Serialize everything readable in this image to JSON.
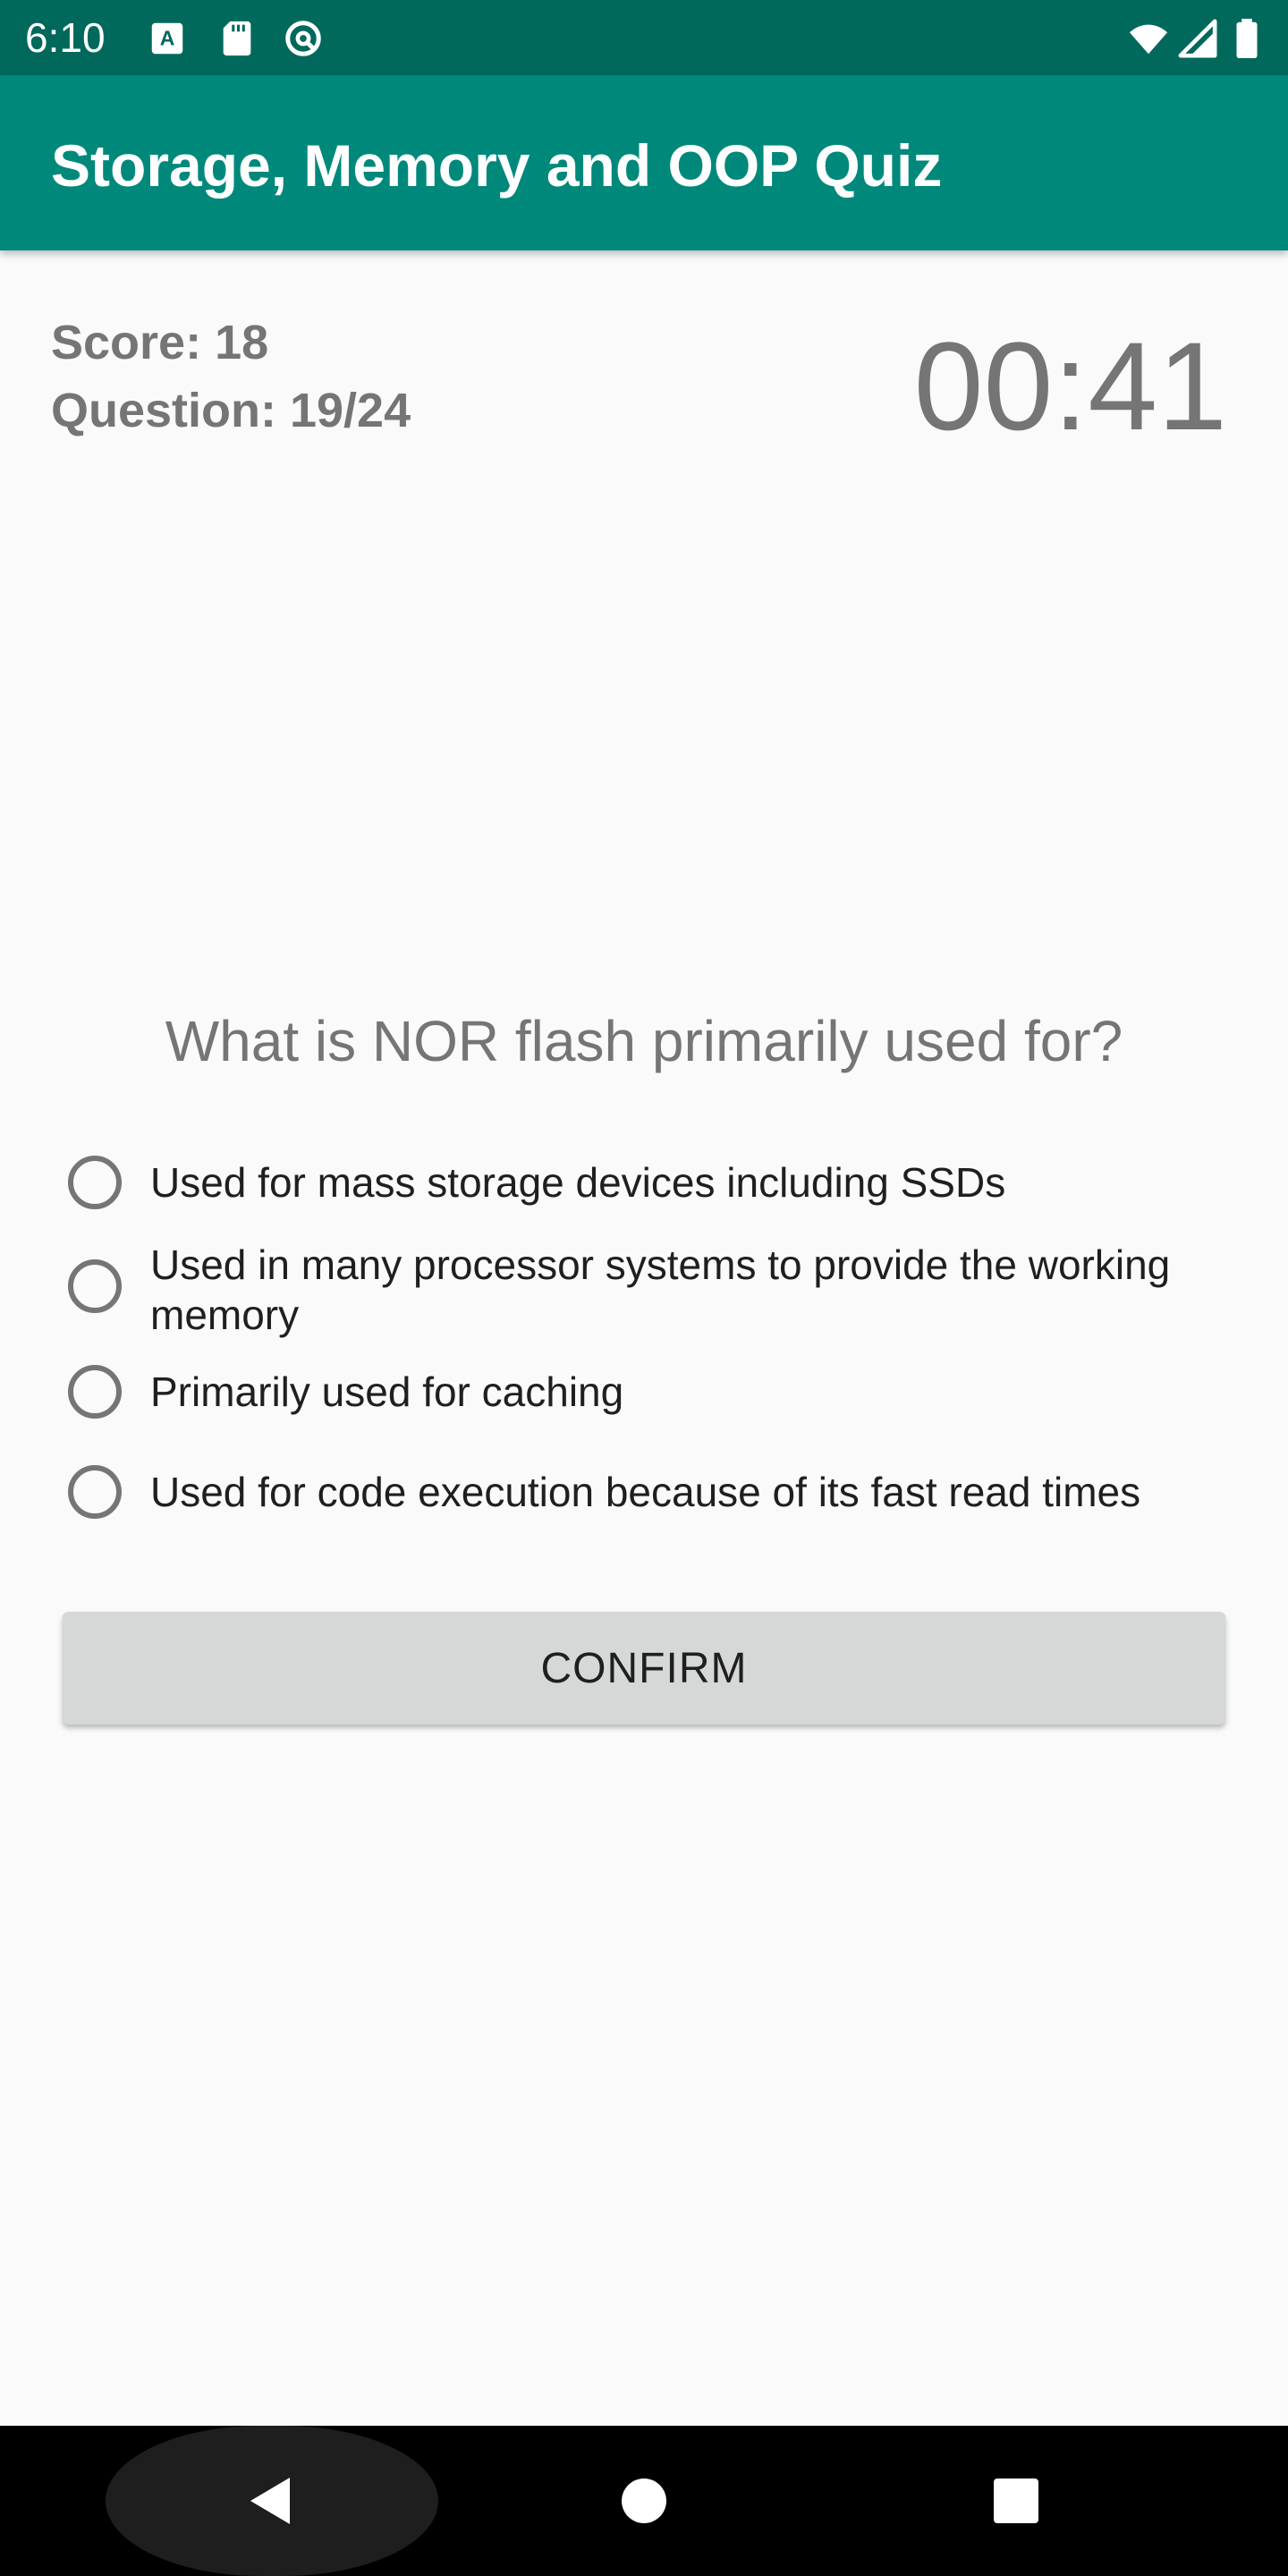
{
  "status_bar": {
    "time": "6:10",
    "left_icons": [
      "keyboard-a-icon",
      "sd-card-icon",
      "no-disturb-icon"
    ],
    "right_icons": [
      "wifi-icon",
      "signal-icon",
      "battery-icon"
    ]
  },
  "app_bar": {
    "title": "Storage, Memory and OOP Quiz",
    "background": "#00897b",
    "status_background": "#00695c"
  },
  "quiz": {
    "score_label": "Score: 18",
    "question_count_label": "Question: 19/24",
    "timer": "00:41",
    "question": "What is NOR flash primarily used for?",
    "options": [
      {
        "label": "Used for mass storage devices including SSDs",
        "selected": false
      },
      {
        "label": "Used in many processor systems to provide the working memory",
        "selected": false
      },
      {
        "label": "Primarily used for caching",
        "selected": false
      },
      {
        "label": "Used for code execution because of its fast read times",
        "selected": false
      }
    ],
    "confirm_label": "CONFIRM"
  },
  "nav_bar": {
    "buttons": [
      "back-icon",
      "home-icon",
      "recents-icon"
    ]
  }
}
